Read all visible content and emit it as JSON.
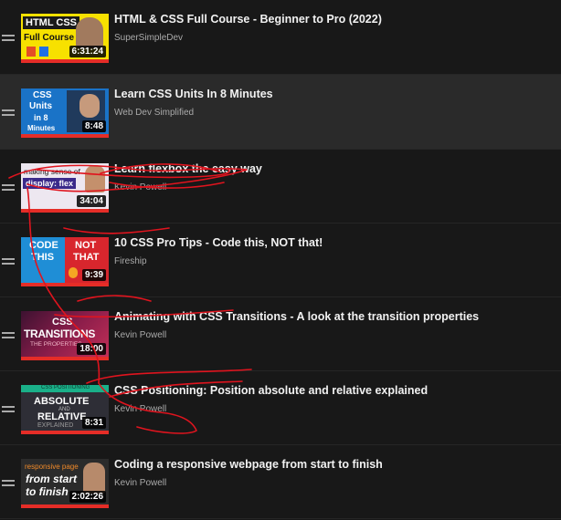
{
  "playlist": {
    "items": [
      {
        "title": "HTML & CSS Full Course - Beginner to Pro (2022)",
        "channel": "SuperSimpleDev",
        "duration": "6:31:24",
        "thumb_text": [
          "HTML CSS",
          "Full Course"
        ],
        "watch_progress": 1.0
      },
      {
        "title": "Learn CSS Units In 8 Minutes",
        "channel": "Web Dev Simplified",
        "duration": "8:48",
        "thumb_text": [
          "CSS",
          "Units",
          "in 8",
          "Minutes"
        ],
        "watch_progress": 1.0
      },
      {
        "title": "Learn flexbox the easy way",
        "channel": "Kevin Powell",
        "duration": "34:04",
        "thumb_text": [
          "making sense of",
          "display: flex"
        ],
        "watch_progress": 1.0
      },
      {
        "title": "10 CSS Pro Tips - Code this, NOT that!",
        "channel": "Fireship",
        "duration": "9:39",
        "thumb_text": [
          "CODE",
          "THIS",
          "NOT",
          "THAT"
        ],
        "watch_progress": 1.0
      },
      {
        "title": "Animating with CSS Transitions - A look at the transition properties",
        "channel": "Kevin Powell",
        "duration": "18:00",
        "thumb_text": [
          "CSS",
          "TRANSITIONS",
          "THE PROPERTIES"
        ],
        "watch_progress": 1.0
      },
      {
        "title": "CSS Positioning: Position absolute and relative explained",
        "channel": "Kevin Powell",
        "duration": "8:31",
        "thumb_text": [
          "CSS POSITIONING",
          "ABSOLUTE",
          "AND",
          "RELATIVE",
          "EXPLAINED"
        ],
        "watch_progress": 1.0
      },
      {
        "title": "Coding a responsive webpage from start to finish",
        "channel": "Kevin Powell",
        "duration": "2:02:26",
        "thumb_text": [
          "responsive page",
          "from start",
          "to finish"
        ],
        "watch_progress": 1.0
      }
    ]
  },
  "colors": {
    "background": "#181818",
    "active_row": "#2a2a2a",
    "progress": "#e52d27",
    "scribble": "#e0141e"
  }
}
